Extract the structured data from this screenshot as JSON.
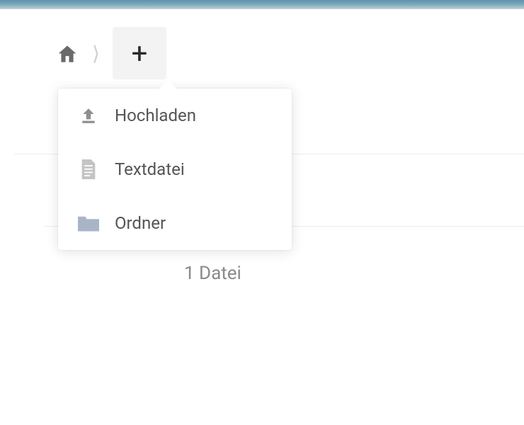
{
  "menu": {
    "upload": {
      "label": "Hochladen"
    },
    "textfile": {
      "label": "Textdatei"
    },
    "folder": {
      "label": "Ordner"
    }
  },
  "background": {
    "partial_label": "1 Datei"
  }
}
